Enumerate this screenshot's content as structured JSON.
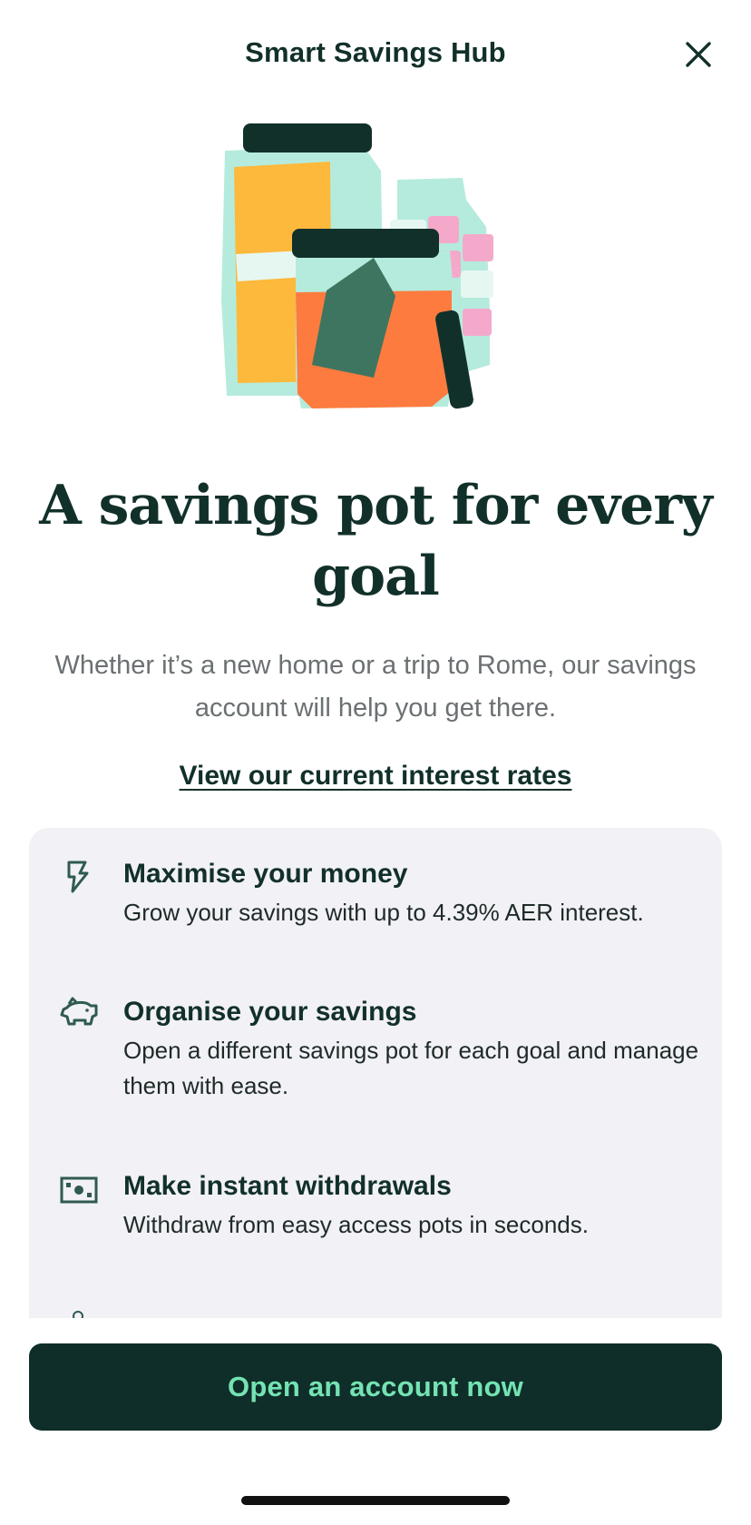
{
  "header": {
    "title": "Smart Savings Hub",
    "close_icon": "close-icon"
  },
  "hero": {
    "icon": "savings-jars-illustration",
    "headline": "A savings pot for every goal",
    "subtitle": "Whether it’s a new home or a trip to Rome, our savings account will help you get there.",
    "rates_link": "View our current interest rates"
  },
  "features": [
    {
      "icon": "lightning-icon",
      "title": "Maximise your money",
      "description": "Grow your savings with up to 4.39% AER interest."
    },
    {
      "icon": "piggy-bank-icon",
      "title": "Organise your savings",
      "description": "Open a different savings pot for each goal and manage them with ease."
    },
    {
      "icon": "banknote-icon",
      "title": "Make instant withdrawals",
      "description": "Withdraw from easy access pots in seconds."
    }
  ],
  "cta": {
    "label": "Open an account now"
  },
  "colors": {
    "primary_dark": "#0f2e29",
    "accent_mint": "#74e3b3",
    "card_background": "#f1f1f6",
    "body_text_muted": "#6b7072"
  }
}
